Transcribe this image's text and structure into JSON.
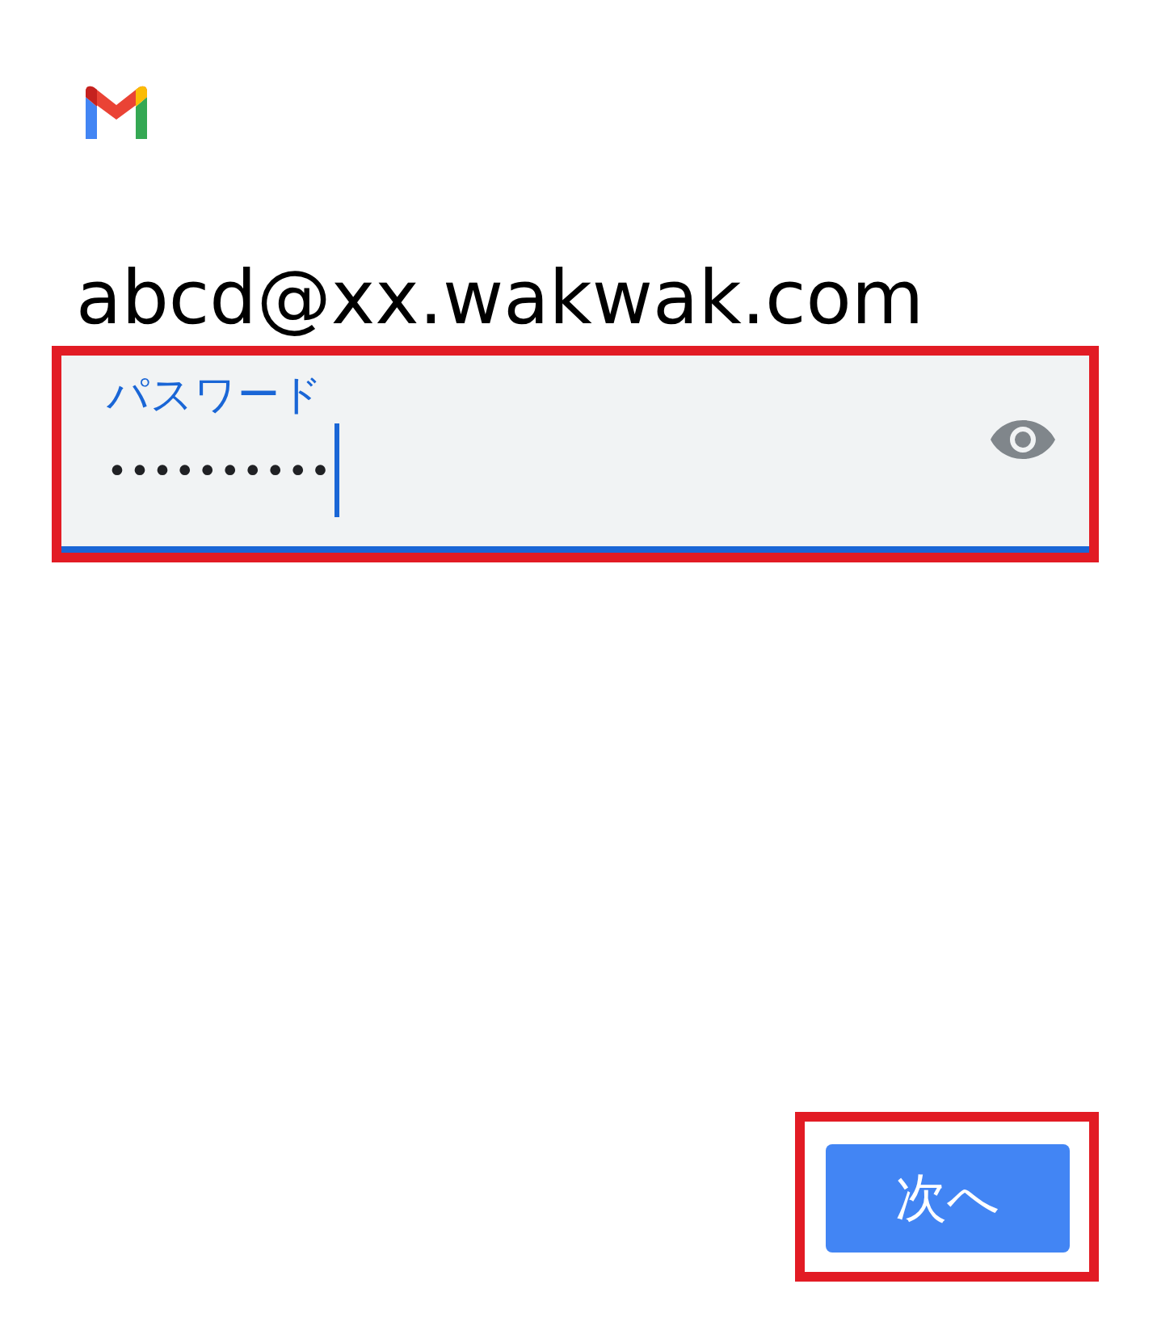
{
  "account": {
    "email": "abcd@xx.wakwak.com"
  },
  "password_field": {
    "label": "パスワード",
    "value": "••••••••••",
    "focused": true,
    "highlighted": true
  },
  "next_button": {
    "label": "次へ",
    "highlighted": true
  }
}
